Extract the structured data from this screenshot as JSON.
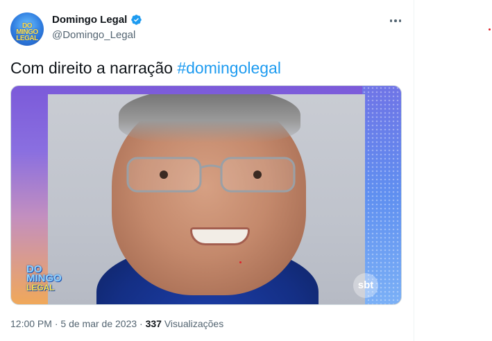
{
  "author": {
    "display_name": "Domingo Legal",
    "handle": "@Domingo_Legal",
    "verified": true,
    "avatar_icon": "domingo-legal-logo-avatar"
  },
  "tweet": {
    "text": "Com direito a narração ",
    "hashtag": "#domingolegal"
  },
  "media": {
    "sbt_logo_text": "sbt",
    "show_logo_icon": "domingo-legal-logo"
  },
  "meta": {
    "time": "12:00 PM",
    "separator1": " · ",
    "date": "5 de mar de 2023",
    "separator2": " · ",
    "views_count": "337",
    "views_label": " Visualizações"
  },
  "colors": {
    "link": "#1d9bf0",
    "verified": "#1d9bf0",
    "muted": "#536471"
  },
  "icons": {
    "more": "more-horizontal-icon",
    "verified": "verified-badge-icon"
  }
}
